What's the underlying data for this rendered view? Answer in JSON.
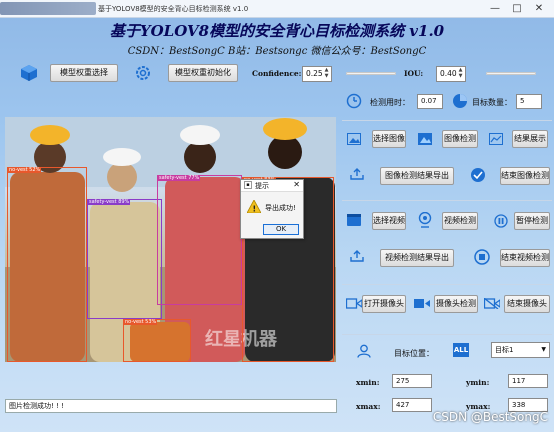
{
  "window": {
    "title": "基于YOLOV8模型的安全背心目标检测系统 v1.0",
    "min": "—",
    "max": "□",
    "close": "✕"
  },
  "header": {
    "title": "基于YOLOV8模型的安全背心目标检测系统 v1.0",
    "subtitle": "CSDN：BestSongC   B站：Bestsongc   微信公众号：BestSongC"
  },
  "toolbar": {
    "select_weights": "模型权重选择",
    "init_weights": "模型权重初始化",
    "confidence_label": "Confidence:",
    "confidence_value": "0.25",
    "confidence_level": 0.25,
    "iou_label": "IOU:",
    "iou_value": "0.40",
    "iou_level": 0.4
  },
  "detections": [
    {
      "label": "no-vest 52%",
      "color": "#e8582c"
    },
    {
      "label": "safety-vest 89%",
      "color": "#8a3cc8"
    },
    {
      "label": "safety-vest 77%",
      "color": "#c83ca0"
    },
    {
      "label": "no-vest 83%",
      "color": "#e8582c"
    },
    {
      "label": "no-vest 53%",
      "color": "#e8582c"
    }
  ],
  "dialog": {
    "title": "提示",
    "message": "导出成功!",
    "ok": "OK",
    "close": "✕"
  },
  "status_bar": {
    "text": "图片检测成功! ! !"
  },
  "right": {
    "time_label": "检测用时：",
    "time_value": "0.07",
    "count_label": "目标数量：",
    "count_value": "5",
    "image_select": "选择图像",
    "image_detect": "图像检测",
    "result_show": "结果展示",
    "image_export": "图像检测结果导出",
    "image_end": "结束图像检测",
    "video_select": "选择视频",
    "video_detect": "视频检测",
    "video_pause": "暂停检测",
    "video_export": "视频检测结果导出",
    "video_end": "结束视频检测",
    "camera_open": "打开摄像头",
    "camera_detect": "摄像头检测",
    "camera_end": "结束摄像头",
    "target_label": "目标位置：",
    "target_select": "目标1",
    "xmin_label": "xmin:",
    "xmin_value": "275",
    "ymin_label": "ymin:",
    "ymin_value": "117",
    "xmax_label": "xmax:",
    "xmax_value": "427",
    "ymax_label": "ymax:",
    "ymax_value": "338"
  },
  "watermark": "CSDN @BestSongC",
  "colors": {
    "accent": "#1a6fd6",
    "title": "#07075a"
  }
}
